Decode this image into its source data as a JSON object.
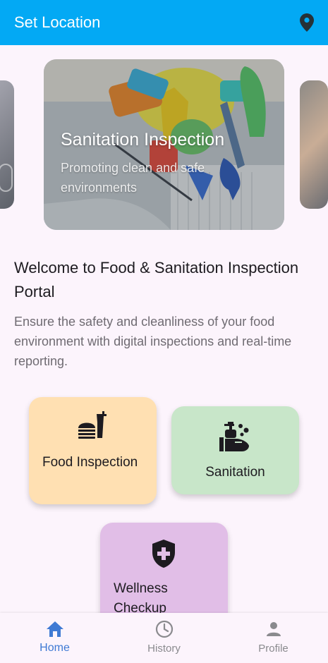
{
  "app_bar": {
    "title": "Set Location",
    "location_icon": "location-pin-icon",
    "background_color": "#03a9f4"
  },
  "carousel": {
    "current": {
      "title": "Sanitation Inspection",
      "subtitle": "Promoting clean and safe environments"
    }
  },
  "welcome": {
    "title": "Welcome to Food & Sanitation Inspection Portal",
    "description": "Ensure the safety and cleanliness of your food environment with digital inspections and real-time reporting."
  },
  "tiles": {
    "food": {
      "label": "Food Inspection",
      "icon": "food-burger-drink-icon",
      "color": "#ffe0b2"
    },
    "sanitation": {
      "label": "Sanitation",
      "icon": "hand-soap-icon",
      "color": "#c8e6c9"
    },
    "wellness": {
      "label": "Wellness Checkup",
      "icon": "medical-shield-icon",
      "color": "#e1bee7"
    }
  },
  "bottom_nav": {
    "items": [
      {
        "label": "Home",
        "icon": "home-icon",
        "active": true
      },
      {
        "label": "History",
        "icon": "clock-icon",
        "active": false
      },
      {
        "label": "Profile",
        "icon": "person-icon",
        "active": false
      }
    ],
    "active_color": "#3f7ad4",
    "inactive_color": "#8a8a8e"
  }
}
